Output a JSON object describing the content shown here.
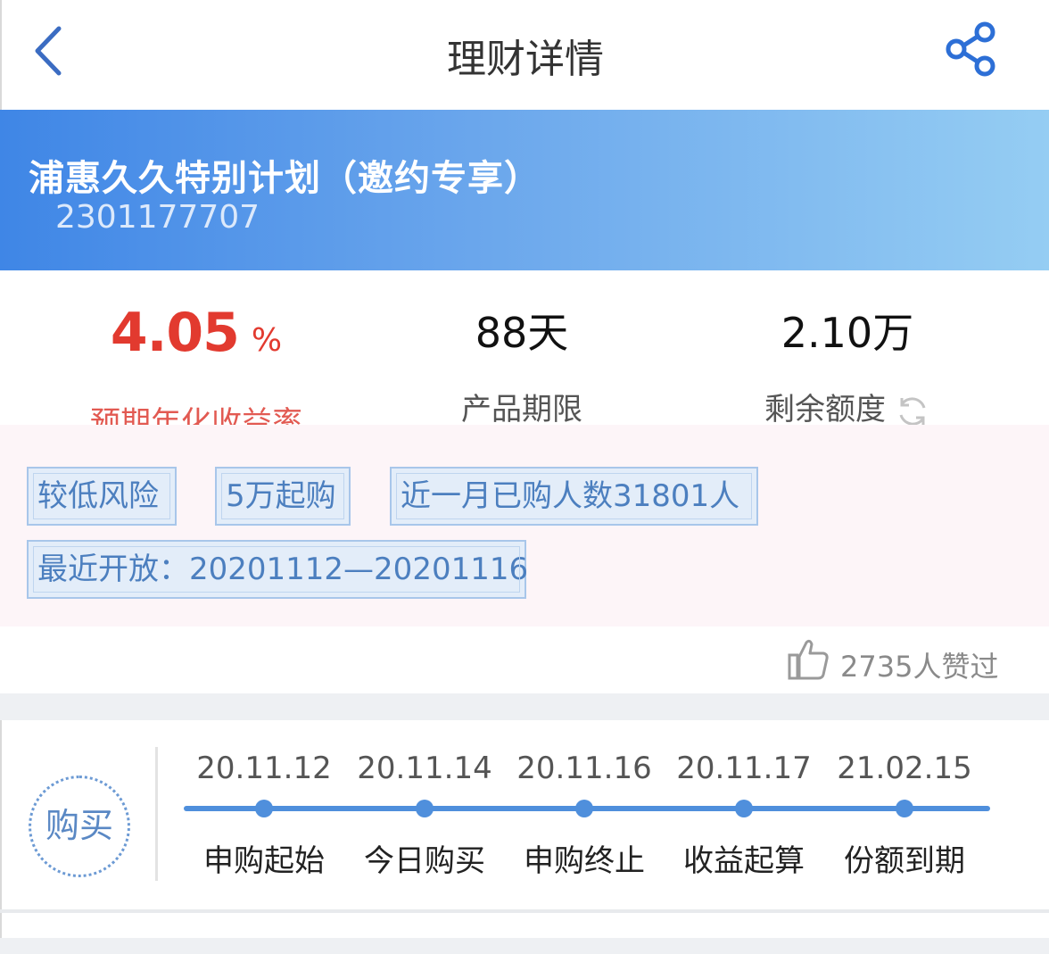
{
  "header": {
    "title": "理财详情",
    "back_icon": "chevron-left-icon",
    "share_icon": "share-icon"
  },
  "product": {
    "name": "浦惠久久特别计划（邀约专享）",
    "code": "2301177707"
  },
  "stats": {
    "rate_value": "4.05",
    "rate_unit": "%",
    "rate_label": "预期年化收益率",
    "term_value": "88天",
    "term_label": "产品期限",
    "remain_value": "2.10万",
    "remain_label": "剩余额度"
  },
  "tags": [
    "较低风险",
    "5万起购",
    "近一月已购人数31801人",
    "最近开放：20201112—20201116"
  ],
  "likes": {
    "text": "2735人赞过"
  },
  "timeline": {
    "buy_label": "购买",
    "steps": [
      {
        "date": "20.11.12",
        "label": "申购起始"
      },
      {
        "date": "20.11.14",
        "label": "今日购买"
      },
      {
        "date": "20.11.16",
        "label": "申购终止"
      },
      {
        "date": "20.11.17",
        "label": "收益起算"
      },
      {
        "date": "21.02.15",
        "label": "份额到期"
      }
    ]
  },
  "colors": {
    "accent_blue": "#4f8fdc",
    "rate_red": "#e23a2f",
    "banner_start": "#3f86e6",
    "banner_end": "#95cdf3"
  }
}
